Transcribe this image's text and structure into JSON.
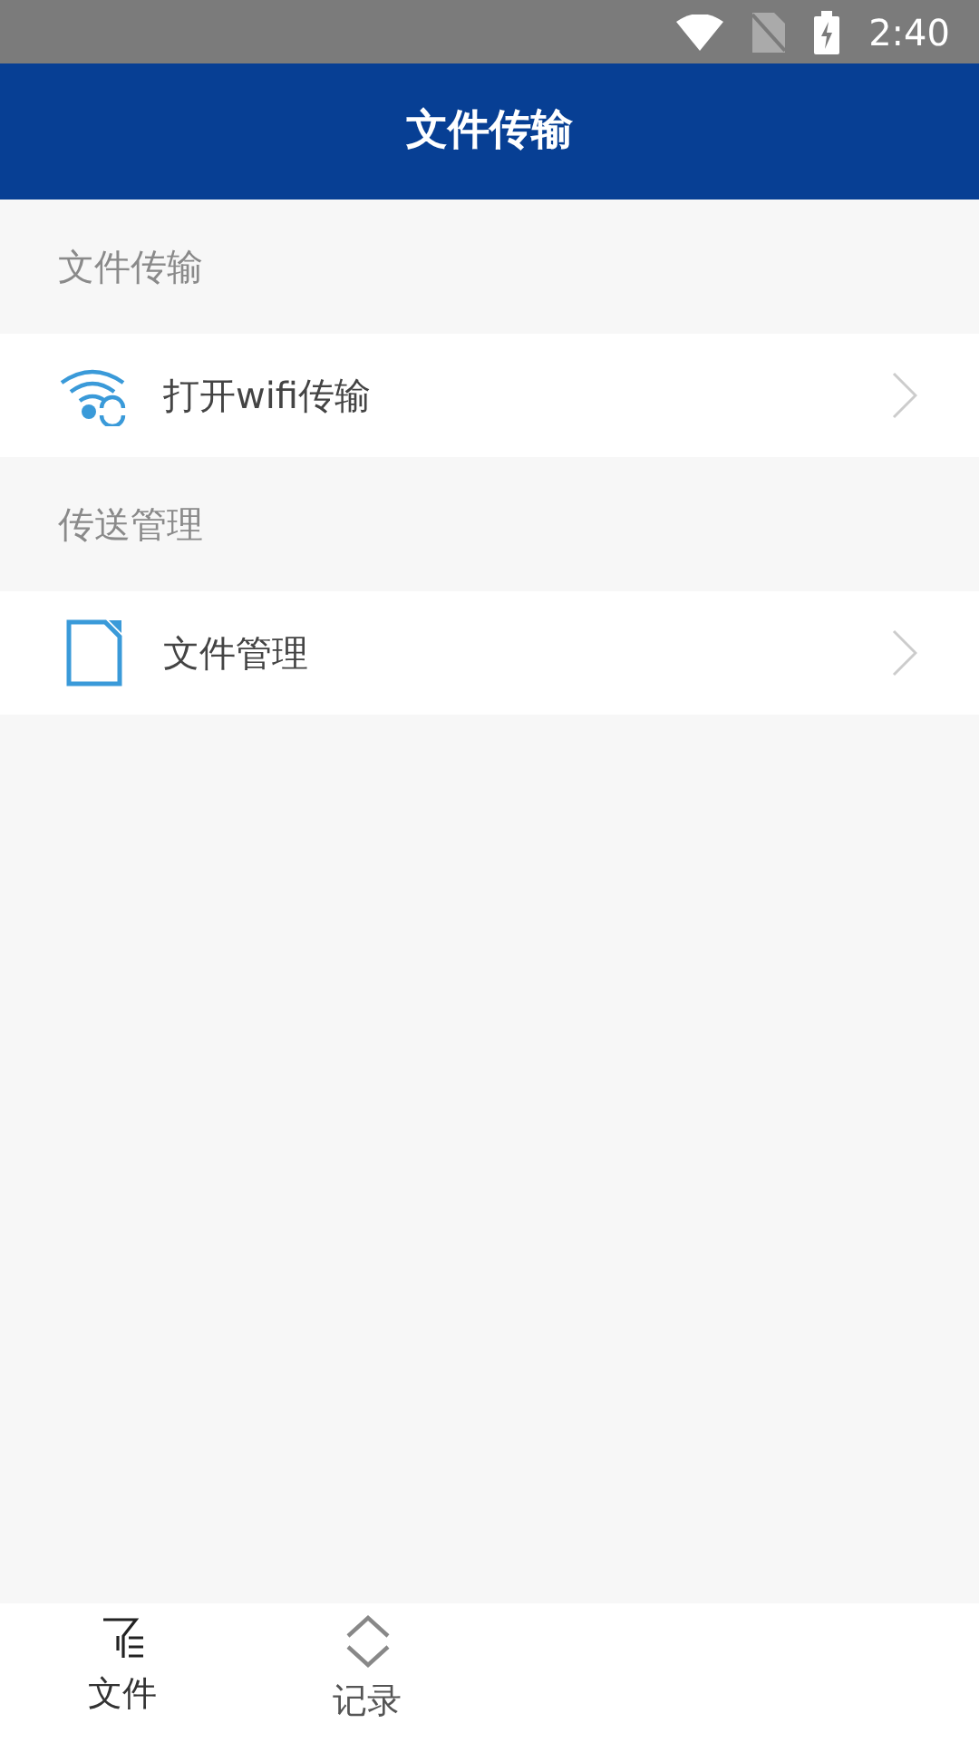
{
  "status_bar": {
    "time": "2:40"
  },
  "header": {
    "title": "文件传输"
  },
  "sections": [
    {
      "title": "文件传输",
      "items": [
        {
          "label": "打开wifi传输",
          "kind": "wifi"
        }
      ]
    },
    {
      "title": "传送管理",
      "items": [
        {
          "label": "文件管理",
          "kind": "file"
        }
      ]
    }
  ],
  "bottom_nav": [
    {
      "label": "文件",
      "kind": "filter",
      "selected": true
    },
    {
      "label": "记录",
      "kind": "updown",
      "selected": false
    }
  ]
}
